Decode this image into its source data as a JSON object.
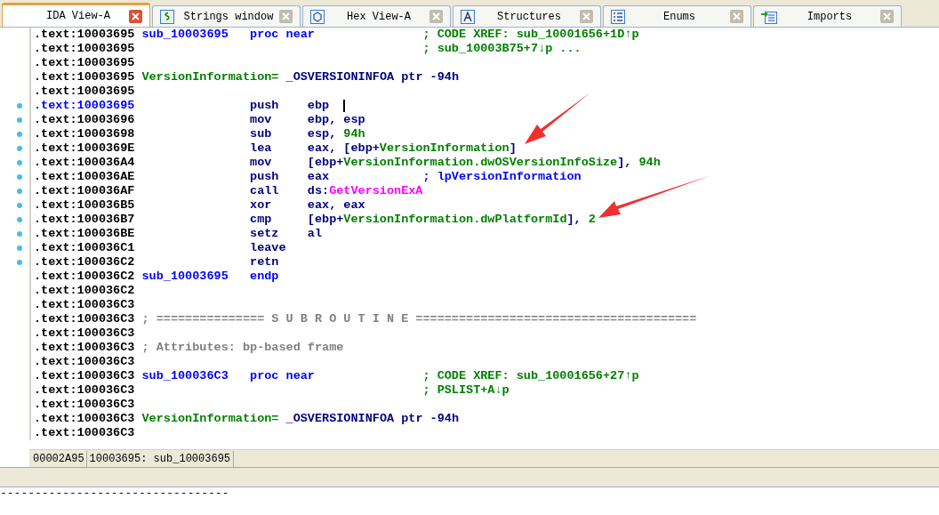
{
  "tabs": [
    {
      "label": "IDA View-A",
      "selected": true
    },
    {
      "label": "Strings window",
      "selected": false
    },
    {
      "label": "Hex View-A",
      "selected": false
    },
    {
      "label": "Structures",
      "selected": false
    },
    {
      "label": "Enums",
      "selected": false
    },
    {
      "label": "Imports",
      "selected": false
    }
  ],
  "listing": [
    {
      "address": ".text:10003695",
      "dot": false,
      "selected": false,
      "kind": "code",
      "label": "sub_10003695",
      "mnemonic": "proc near",
      "comment": "; CODE XREF: sub_10001656+1D↑p"
    },
    {
      "address": ".text:10003695",
      "dot": false,
      "selected": false,
      "kind": "code",
      "comment": "; sub_10003B75+7↓p ..."
    },
    {
      "address": ".text:10003695",
      "dot": false,
      "selected": false,
      "kind": "blank"
    },
    {
      "address": ".text:10003695",
      "dot": false,
      "selected": false,
      "kind": "var",
      "name": "VersionInformation=",
      "type": "_OSVERSIONINFOA ptr -94h"
    },
    {
      "address": ".text:10003695",
      "dot": false,
      "selected": false,
      "kind": "blank"
    },
    {
      "address": ".text:10003695",
      "dot": true,
      "selected": true,
      "kind": "code",
      "mnemonic": "push",
      "operands": [
        {
          "text": "ebp",
          "kind": "reg"
        }
      ]
    },
    {
      "address": ".text:10003696",
      "dot": true,
      "selected": false,
      "kind": "code",
      "mnemonic": "mov",
      "operands": [
        {
          "text": "ebp, esp",
          "kind": "reg"
        }
      ]
    },
    {
      "address": ".text:10003698",
      "dot": true,
      "selected": false,
      "kind": "code",
      "mnemonic": "sub",
      "operands": [
        {
          "text": "esp, ",
          "kind": "reg"
        },
        {
          "text": "94h",
          "kind": "num"
        }
      ]
    },
    {
      "address": ".text:1000369E",
      "dot": true,
      "selected": false,
      "kind": "code",
      "mnemonic": "lea",
      "operands": [
        {
          "text": "eax, [ebp+",
          "kind": "reg"
        },
        {
          "text": "VersionInformation",
          "kind": "var"
        },
        {
          "text": "]",
          "kind": "reg"
        }
      ]
    },
    {
      "address": ".text:100036A4",
      "dot": true,
      "selected": false,
      "kind": "code",
      "mnemonic": "mov",
      "operands": [
        {
          "text": "[ebp+",
          "kind": "reg"
        },
        {
          "text": "VersionInformation.dwOSVersionInfoSize",
          "kind": "var"
        },
        {
          "text": "], ",
          "kind": "reg"
        },
        {
          "text": "94h",
          "kind": "num"
        }
      ]
    },
    {
      "address": ".text:100036AE",
      "dot": true,
      "selected": false,
      "kind": "code",
      "mnemonic": "push",
      "operands": [
        {
          "text": "eax",
          "kind": "reg"
        }
      ],
      "comment": "; lpVersionInformation"
    },
    {
      "address": ".text:100036AF",
      "dot": true,
      "selected": false,
      "kind": "code",
      "mnemonic": "call",
      "operands": [
        {
          "text": "ds:",
          "kind": "reg"
        },
        {
          "text": "GetVersionExA",
          "kind": "import"
        }
      ]
    },
    {
      "address": ".text:100036B5",
      "dot": true,
      "selected": false,
      "kind": "code",
      "mnemonic": "xor",
      "operands": [
        {
          "text": "eax, eax",
          "kind": "reg"
        }
      ]
    },
    {
      "address": ".text:100036B7",
      "dot": true,
      "selected": false,
      "kind": "code",
      "mnemonic": "cmp",
      "operands": [
        {
          "text": "[ebp+",
          "kind": "reg"
        },
        {
          "text": "VersionInformation.dwPlatformId",
          "kind": "var"
        },
        {
          "text": "], ",
          "kind": "reg"
        },
        {
          "text": "2",
          "kind": "num"
        }
      ]
    },
    {
      "address": ".text:100036BE",
      "dot": true,
      "selected": false,
      "kind": "code",
      "mnemonic": "setz",
      "operands": [
        {
          "text": "al",
          "kind": "reg"
        }
      ]
    },
    {
      "address": ".text:100036C1",
      "dot": true,
      "selected": false,
      "kind": "code",
      "mnemonic": "leave"
    },
    {
      "address": ".text:100036C2",
      "dot": true,
      "selected": false,
      "kind": "code",
      "mnemonic": "retn"
    },
    {
      "address": ".text:100036C2",
      "dot": false,
      "selected": false,
      "kind": "code",
      "label": "sub_10003695",
      "mnemonic": "endp"
    },
    {
      "address": ".text:100036C2",
      "dot": false,
      "selected": false,
      "kind": "blank"
    },
    {
      "address": ".text:100036C3",
      "dot": false,
      "selected": false,
      "kind": "blank"
    },
    {
      "address": ".text:100036C3",
      "dot": false,
      "selected": false,
      "kind": "note",
      "text": "; =============== S U B R O U T I N E ======================================="
    },
    {
      "address": ".text:100036C3",
      "dot": false,
      "selected": false,
      "kind": "blank"
    },
    {
      "address": ".text:100036C3",
      "dot": false,
      "selected": false,
      "kind": "note",
      "text": "; Attributes: bp-based frame"
    },
    {
      "address": ".text:100036C3",
      "dot": false,
      "selected": false,
      "kind": "blank"
    },
    {
      "address": ".text:100036C3",
      "dot": false,
      "selected": false,
      "kind": "code",
      "label": "sub_100036C3",
      "mnemonic": "proc near",
      "comment": "; CODE XREF: sub_10001656+27↑p"
    },
    {
      "address": ".text:100036C3",
      "dot": false,
      "selected": false,
      "kind": "code",
      "comment": "; PSLIST+A↓p"
    },
    {
      "address": ".text:100036C3",
      "dot": false,
      "selected": false,
      "kind": "blank"
    },
    {
      "address": ".text:100036C3",
      "dot": false,
      "selected": false,
      "kind": "var",
      "name": "VersionInformation=",
      "type": "_OSVERSIONINFOA ptr -94h"
    },
    {
      "address": ".text:100036C3",
      "dot": false,
      "selected": false,
      "kind": "blank"
    }
  ],
  "status_bar": {
    "offset": "00002A95",
    "location": "10003695: sub_10003695"
  },
  "output": "---------------------------------"
}
